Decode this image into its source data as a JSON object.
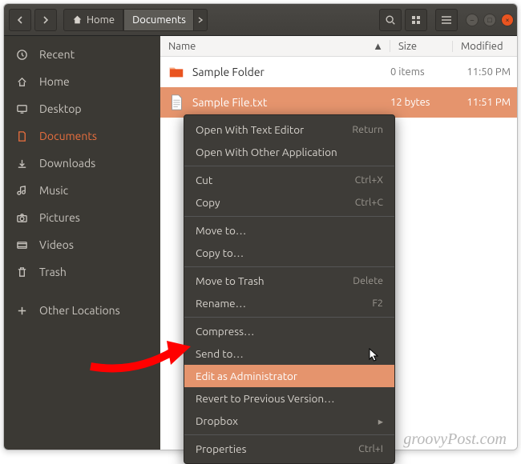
{
  "colors": {
    "accent": "#e95420",
    "highlight": "#e5946d"
  },
  "path": {
    "home_label": "Home",
    "current": "Documents"
  },
  "sidebar": {
    "items": [
      {
        "label": "Recent",
        "icon": "clock-icon"
      },
      {
        "label": "Home",
        "icon": "home-icon"
      },
      {
        "label": "Desktop",
        "icon": "desktop-icon"
      },
      {
        "label": "Documents",
        "icon": "document-icon",
        "active": true
      },
      {
        "label": "Downloads",
        "icon": "download-icon"
      },
      {
        "label": "Music",
        "icon": "music-icon"
      },
      {
        "label": "Pictures",
        "icon": "camera-icon"
      },
      {
        "label": "Videos",
        "icon": "video-icon"
      },
      {
        "label": "Trash",
        "icon": "trash-icon"
      }
    ],
    "other": {
      "label": "Other Locations",
      "icon": "plus-icon"
    }
  },
  "columns": {
    "name": "Name",
    "size": "Size",
    "modified": "Modified"
  },
  "rows": [
    {
      "name": "Sample Folder",
      "size": "0 items",
      "modified": "11:50 PM",
      "type": "folder"
    },
    {
      "name": "Sample File.txt",
      "size": "12 bytes",
      "modified": "11:51 PM",
      "type": "file",
      "selected": true
    }
  ],
  "context_menu": {
    "items": [
      {
        "label": "Open With Text Editor",
        "shortcut": "Return"
      },
      {
        "label": "Open With Other Application"
      },
      {
        "sep": true
      },
      {
        "label": "Cut",
        "shortcut": "Ctrl+X"
      },
      {
        "label": "Copy",
        "shortcut": "Ctrl+C"
      },
      {
        "sep": true
      },
      {
        "label": "Move to…"
      },
      {
        "label": "Copy to…"
      },
      {
        "sep": true
      },
      {
        "label": "Move to Trash",
        "shortcut": "Delete"
      },
      {
        "label": "Rename…",
        "shortcut": "F2"
      },
      {
        "sep": true
      },
      {
        "label": "Compress…"
      },
      {
        "label": "Send to…"
      },
      {
        "label": "Edit as Administrator",
        "highlight": true
      },
      {
        "label": "Revert to Previous Version…"
      },
      {
        "label": "Dropbox",
        "submenu": true
      },
      {
        "sep": true
      },
      {
        "label": "Properties",
        "shortcut": "Ctrl+I"
      }
    ]
  },
  "watermark": "groovyPost.com"
}
